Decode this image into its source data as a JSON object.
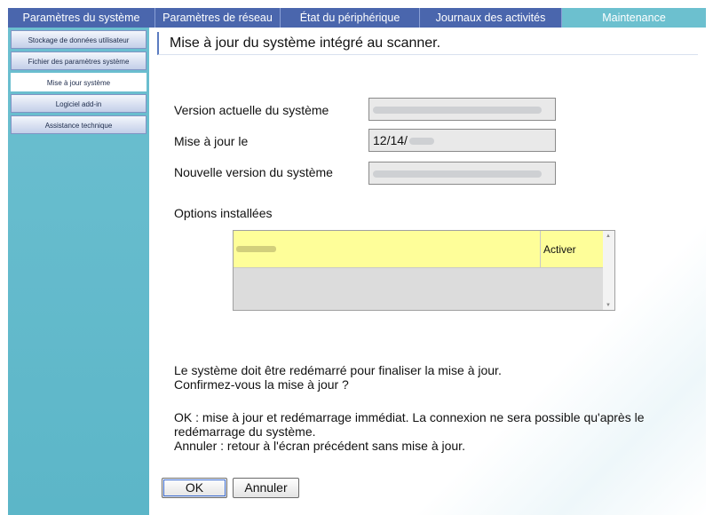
{
  "tabs": [
    {
      "label": "Paramètres du système",
      "active": false
    },
    {
      "label": "Paramètres de réseau",
      "active": false
    },
    {
      "label": "État du périphérique",
      "active": false
    },
    {
      "label": "Journaux des activités",
      "active": false
    },
    {
      "label": "Maintenance",
      "active": true
    }
  ],
  "sidebar": {
    "items": [
      {
        "label": "Stockage de données utilisateur",
        "active": false
      },
      {
        "label": "Fichier des paramètres système",
        "active": false
      },
      {
        "label": "Mise à jour système",
        "active": true
      },
      {
        "label": "Logiciel add-in",
        "active": false
      },
      {
        "label": "Assistance technique",
        "active": false
      }
    ]
  },
  "main": {
    "title": "Mise à jour du système intégré au scanner.",
    "current_version_label": "Version actuelle du système",
    "update_date_label": "Mise à jour le",
    "update_date_value": "12/14/",
    "new_version_label": "Nouvelle version du système",
    "options_label": "Options installées",
    "option_status": "Activer",
    "message_line1": "Le système doit être redémarré pour finaliser la mise à jour.",
    "message_line2": "Confirmez-vous la mise à jour ?",
    "ok_info_line1": "OK : mise à jour et redémarrage immédiat. La connexion ne sera possible qu'après le",
    "ok_info_line2": "redémarrage du système.",
    "cancel_info": "Annuler : retour à l'écran précédent sans mise à jour.",
    "ok_button": "OK",
    "cancel_button": "Annuler"
  },
  "colors": {
    "nav_bar": "#4a66ad",
    "active_tab": "#6cc0cf",
    "sidebar_bg": "#5cb6c8",
    "selected_option_row": "#fefe99"
  }
}
